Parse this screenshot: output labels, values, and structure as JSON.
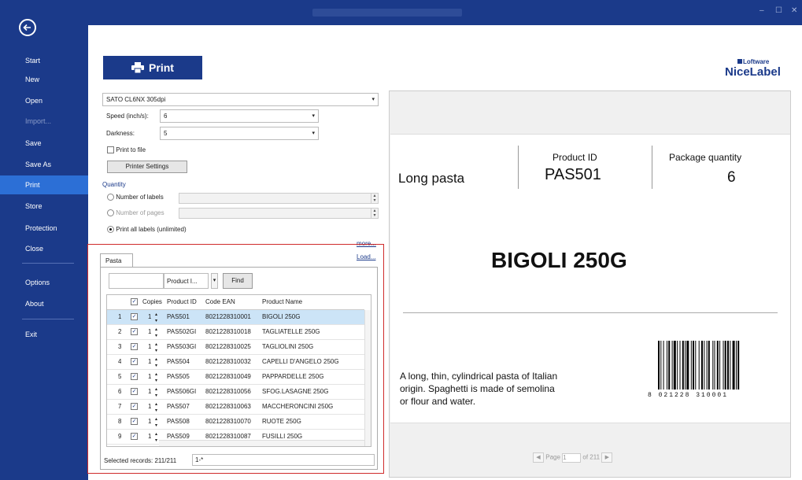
{
  "sidebar": {
    "items": [
      {
        "label": "Start",
        "state": "normal"
      },
      {
        "label": "New",
        "state": "normal"
      },
      {
        "label": "Open",
        "state": "normal"
      },
      {
        "label": "Import...",
        "state": "disabled"
      },
      {
        "label": "Save",
        "state": "normal"
      },
      {
        "label": "Save As",
        "state": "normal"
      },
      {
        "label": "Print",
        "state": "active"
      },
      {
        "label": "Store",
        "state": "normal"
      },
      {
        "label": "Protection",
        "state": "normal"
      },
      {
        "label": "Close",
        "state": "normal"
      },
      {
        "label": "Options",
        "state": "normal"
      },
      {
        "label": "About",
        "state": "normal"
      },
      {
        "label": "Exit",
        "state": "normal"
      }
    ]
  },
  "window": {
    "minimize": "–",
    "maximize": "☐",
    "close": "✕"
  },
  "print_button": {
    "label": "Print",
    "icon": "printer-icon"
  },
  "brand": {
    "small": "Loftware",
    "big": "NiceLabel"
  },
  "printer": {
    "selected": "SATO CL6NX 305dpi",
    "speed_label": "Speed (inch/s):",
    "speed_value": "6",
    "darkness_label": "Darkness:",
    "darkness_value": "5",
    "print_to_file": "Print to file",
    "settings_button": "Printer Settings"
  },
  "quantity": {
    "heading": "Quantity",
    "number_of_labels": "Number of labels",
    "number_of_pages": "Number of pages",
    "print_all": "Print all labels (unlimited)",
    "more_link": "more..."
  },
  "data": {
    "tab": "Pasta",
    "load_link": "Load...",
    "search_field": "Product I...",
    "find_button": "Find",
    "columns": [
      "Copies",
      "Product ID",
      "Code EAN",
      "Product Name"
    ],
    "rows": [
      {
        "n": "1",
        "copies": "1",
        "id": "PAS501",
        "ean": "8021228310001",
        "name": "BIGOLI 250G"
      },
      {
        "n": "2",
        "copies": "1",
        "id": "PAS502GI",
        "ean": "8021228310018",
        "name": "TAGLIATELLE 250G"
      },
      {
        "n": "3",
        "copies": "1",
        "id": "PAS503GI",
        "ean": "8021228310025",
        "name": "TAGLIOLINI 250G"
      },
      {
        "n": "4",
        "copies": "1",
        "id": "PAS504",
        "ean": "8021228310032",
        "name": "CAPELLI D'ANGELO 250G"
      },
      {
        "n": "5",
        "copies": "1",
        "id": "PAS505",
        "ean": "8021228310049",
        "name": "PAPPARDELLE 250G"
      },
      {
        "n": "6",
        "copies": "1",
        "id": "PAS506GI",
        "ean": "8021228310056",
        "name": "SFOG.LASAGNE 250G"
      },
      {
        "n": "7",
        "copies": "1",
        "id": "PAS507",
        "ean": "8021228310063",
        "name": "MACCHERONCINI 250G"
      },
      {
        "n": "8",
        "copies": "1",
        "id": "PAS508",
        "ean": "8021228310070",
        "name": "RUOTE 250G"
      },
      {
        "n": "9",
        "copies": "1",
        "id": "PAS509",
        "ean": "8021228310087",
        "name": "FUSILLI 250G"
      }
    ],
    "status_label": "Selected records: 211/211",
    "status_value": "1-*"
  },
  "label": {
    "product_name": "Long pasta",
    "product_id_caption": "Product ID",
    "product_id": "PAS501",
    "package_caption": "Package quantity",
    "package_qty": "6",
    "title": "BIGOLI 250G",
    "description": [
      "A long, thin, cylindrical pasta of Italian",
      "origin. Spaghetti is made of semolina",
      "or flour and water."
    ],
    "barcode_digits": "8  021228  310001"
  },
  "pager": {
    "page_label": "Page",
    "page_value": "1",
    "of_label": "of 211"
  }
}
